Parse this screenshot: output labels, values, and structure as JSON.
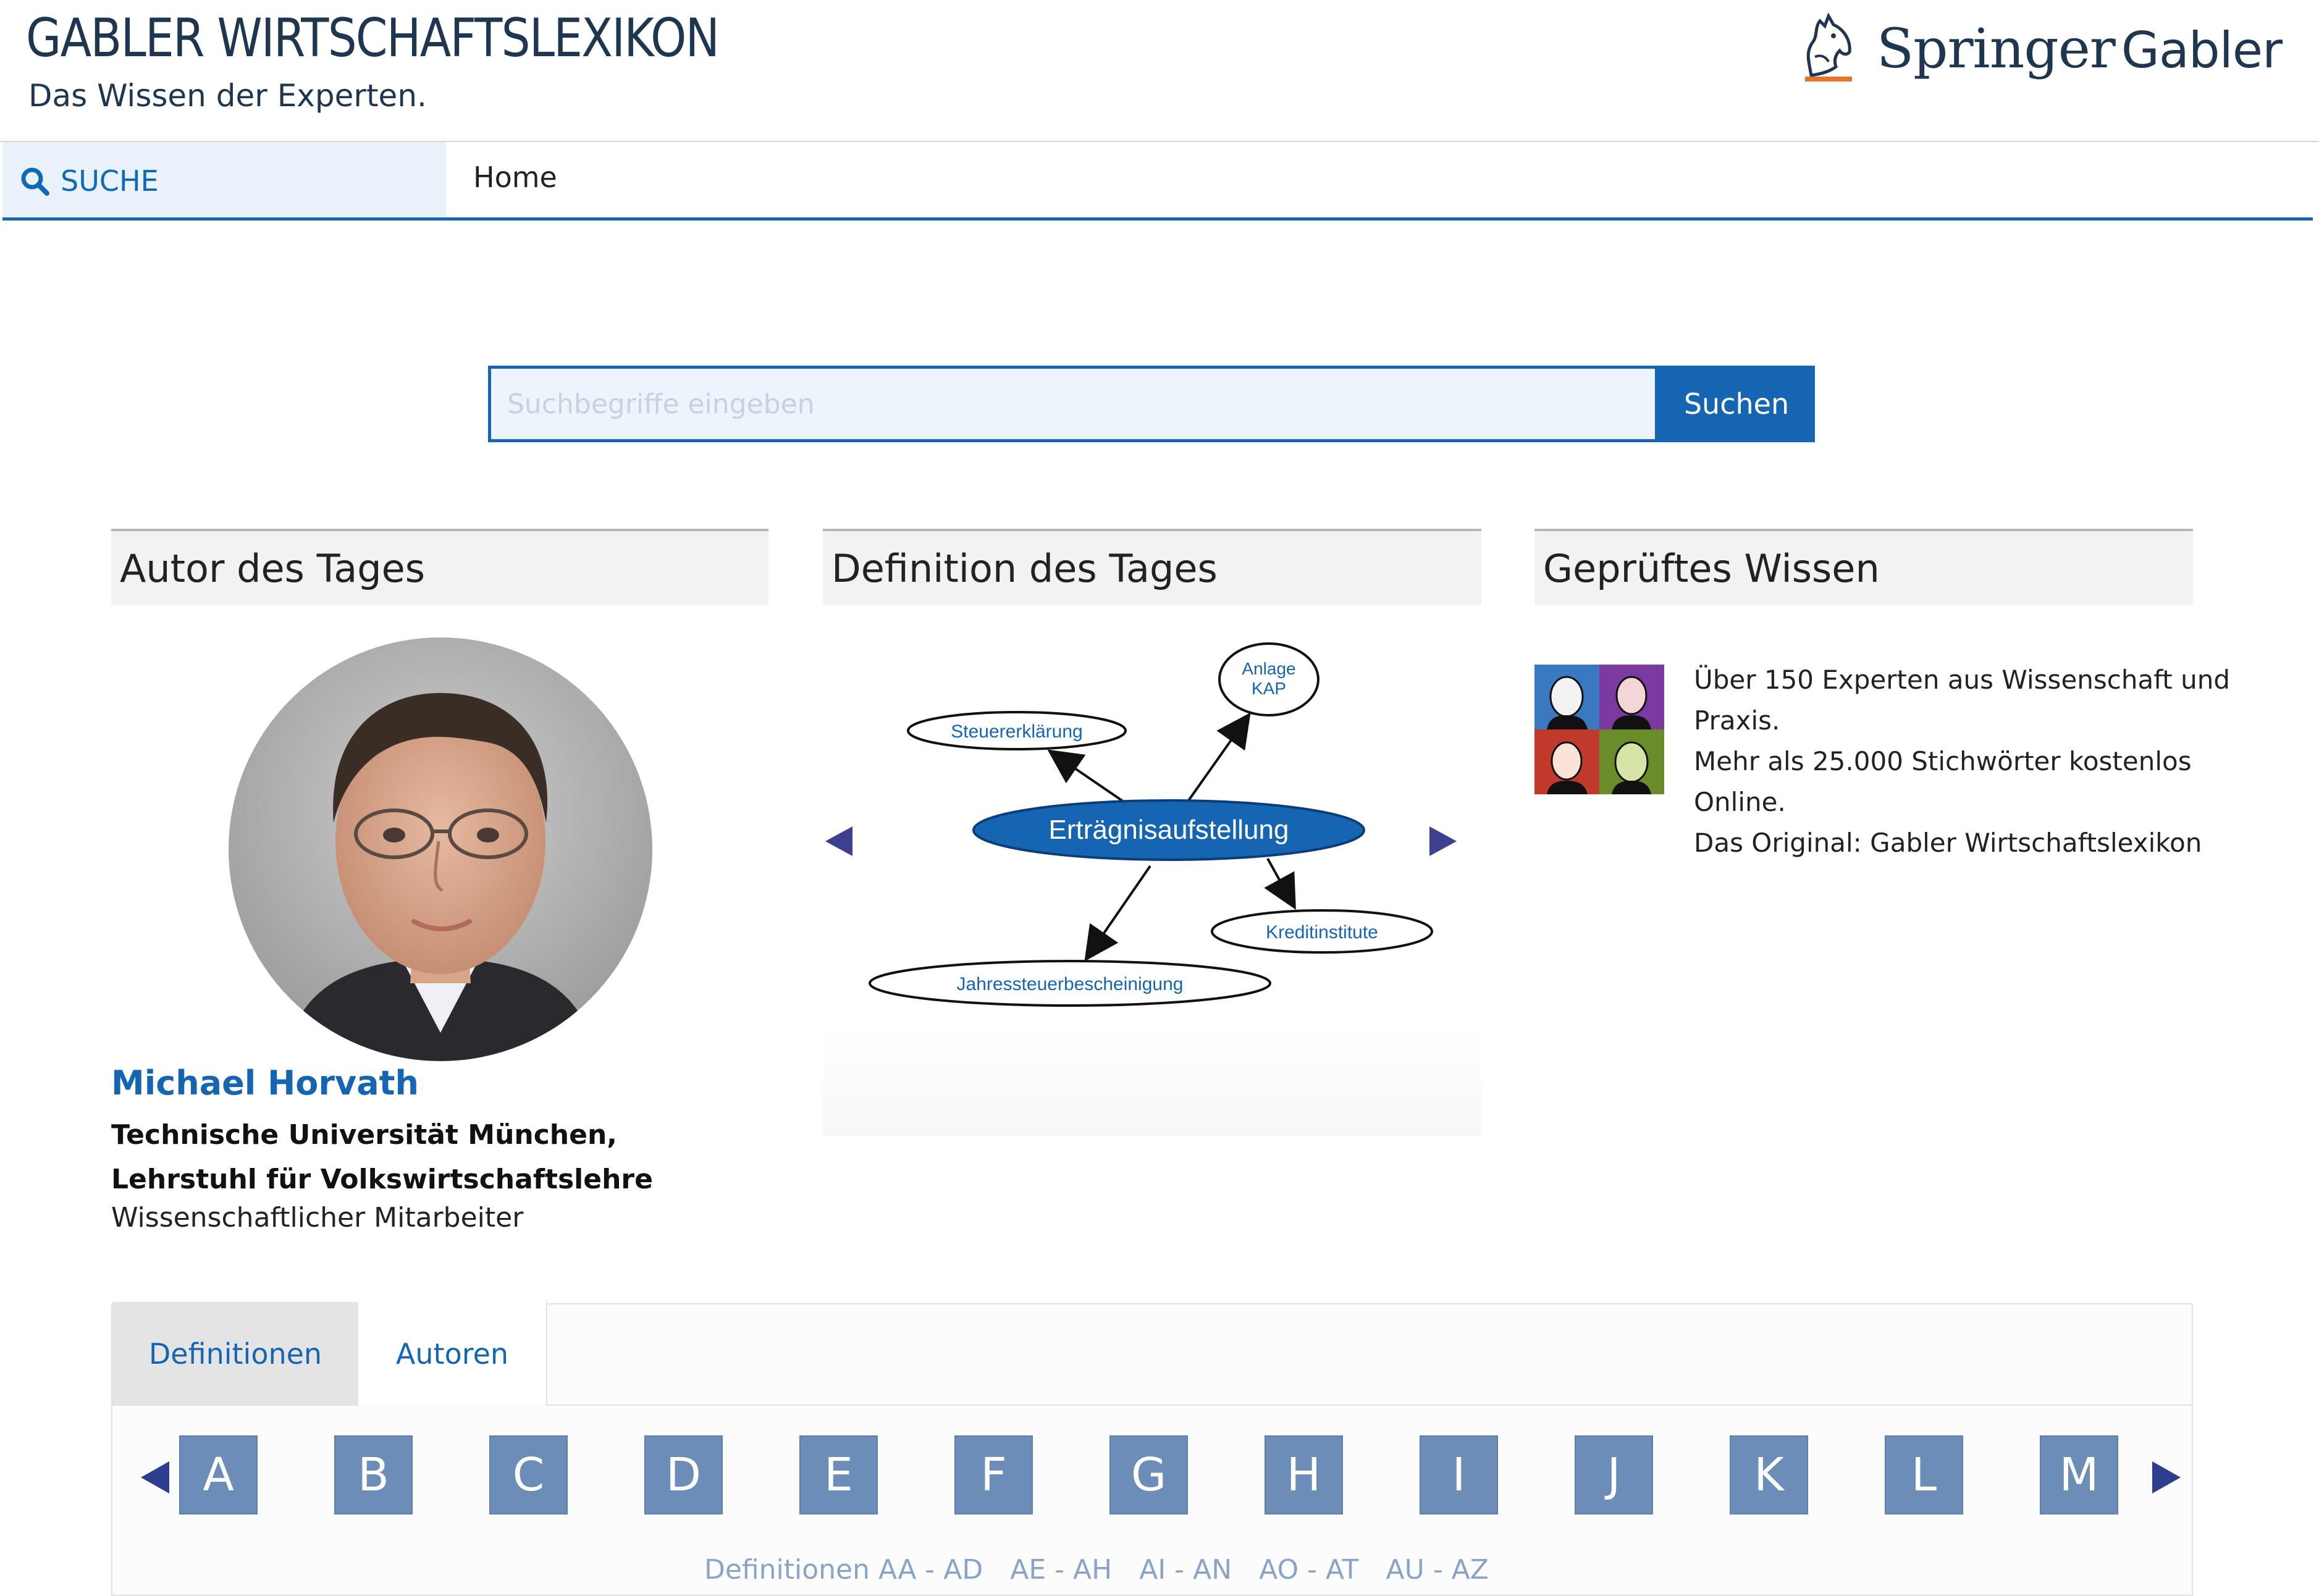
{
  "header": {
    "title": "GABLER WIRTSCHAFTSLEXIKON",
    "subtitle": "Das Wissen der Experten.",
    "publisher": "Springer",
    "publisher_suffix": "Gabler"
  },
  "nav": {
    "search_label": "SUCHE",
    "home_label": "Home"
  },
  "search": {
    "placeholder": "Suchbegriffe eingeben",
    "button": "Suchen"
  },
  "author_panel": {
    "heading": "Autor des Tages",
    "name": "Michael Horvath",
    "institution": "Technische Universität München, Lehrstuhl für Volkswirtschaftslehre",
    "role": "Wissenschaftlicher Mitarbeiter"
  },
  "definition_panel": {
    "heading": "Definition des Tages",
    "center": "Erträgnisaufstellung",
    "nodes": [
      "Steuererklärung",
      "Anlage KAP",
      "Kreditinstitute",
      "Jahressteuerbescheinigung"
    ],
    "node_anlage_line1": "Anlage",
    "node_anlage_line2": "KAP"
  },
  "wissen_panel": {
    "heading": "Geprüftes Wissen",
    "lines": [
      "Über 150 Experten aus Wissenschaft und",
      "Praxis.",
      "Mehr als 25.000 Stichwörter kostenlos",
      "Online.",
      "Das Original: Gabler Wirtschaftslexikon"
    ]
  },
  "tabs": {
    "definitionen": "Definitionen",
    "autoren": "Autoren"
  },
  "letters": [
    "A",
    "B",
    "C",
    "D",
    "E",
    "F",
    "G",
    "H",
    "I",
    "J",
    "K",
    "L",
    "M"
  ],
  "ranges": [
    "Definitionen AA - AD",
    "AE - AH",
    "AI - AN",
    "AO - AT",
    "AU - AZ"
  ],
  "colors": {
    "accent": "#1565b2",
    "letter_tile": "#6b8db8",
    "nav_arrow": "#2d3d8f"
  },
  "icons": {
    "search": "search-icon",
    "publisher_logo": "springer-horse-icon"
  }
}
